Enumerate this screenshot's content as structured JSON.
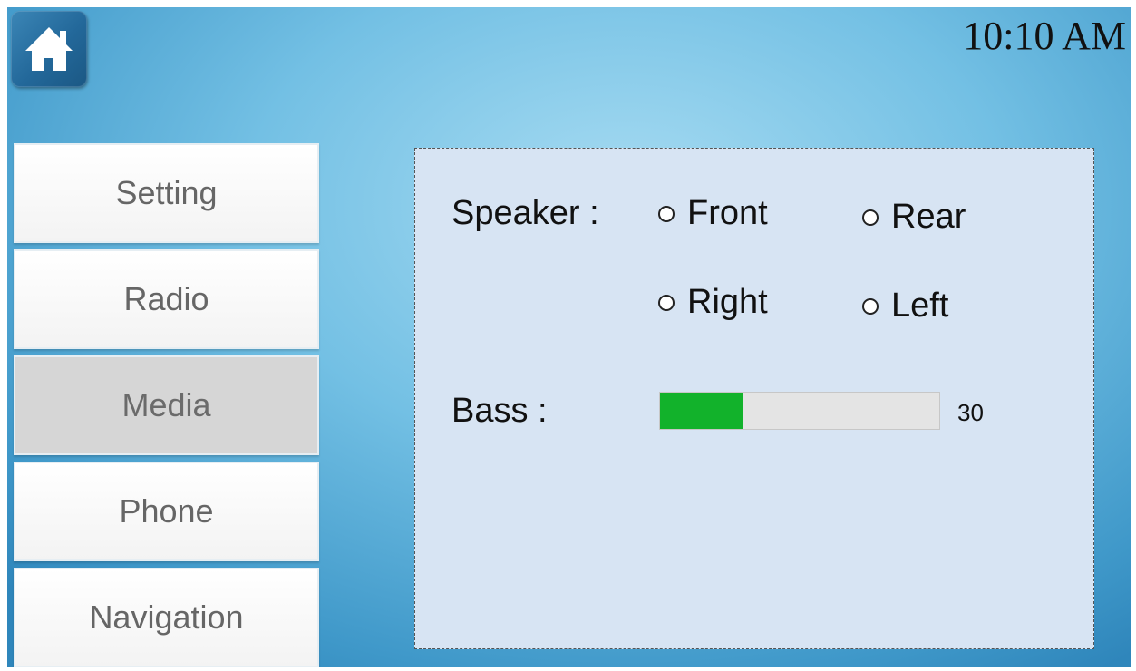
{
  "header": {
    "time": "10:10 AM",
    "home_icon": "home-icon"
  },
  "menu": {
    "items": [
      {
        "label": "Setting",
        "active": false
      },
      {
        "label": "Radio",
        "active": false
      },
      {
        "label": "Media",
        "active": true
      },
      {
        "label": "Phone",
        "active": false
      },
      {
        "label": "Navigation",
        "active": false
      }
    ]
  },
  "panel": {
    "speaker_label": "Speaker :",
    "speaker_options": [
      "Front",
      "Rear",
      "Right",
      "Left"
    ],
    "bass_label": "Bass :",
    "bass_value": "30",
    "bass_level": 30,
    "bass_max": 100
  },
  "colors": {
    "accent": "#12b22b",
    "panel_bg": "#d7e4f3",
    "home_button": "#23689a"
  }
}
